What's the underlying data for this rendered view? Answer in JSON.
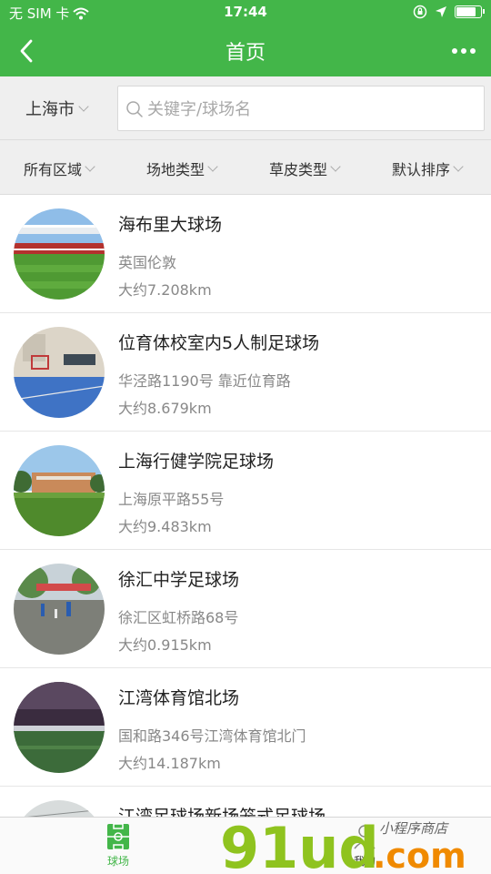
{
  "status_bar": {
    "carrier": "无 SIM 卡",
    "time": "17:44",
    "battery_level": 0.85
  },
  "nav": {
    "title": "首页",
    "back_icon": "chevron-left-icon",
    "more_icon": "more-dots-icon"
  },
  "search": {
    "city": "上海市",
    "placeholder": "关键字/球场名"
  },
  "filters": [
    {
      "label": "所有区域"
    },
    {
      "label": "场地类型"
    },
    {
      "label": "草皮类型"
    },
    {
      "label": "默认排序"
    }
  ],
  "venues": [
    {
      "name": "海布里大球场",
      "address": "英国伦敦",
      "distance": "大约7.208km"
    },
    {
      "name": "位育体校室内5人制足球场",
      "address": "华泾路1190号 靠近位育路",
      "distance": "大约8.679km"
    },
    {
      "name": "上海行健学院足球场",
      "address": "上海原平路55号",
      "distance": "大约9.483km"
    },
    {
      "name": "徐汇中学足球场",
      "address": "徐汇区虹桥路68号",
      "distance": "大约0.915km"
    },
    {
      "name": "江湾体育馆北场",
      "address": "国和路346号江湾体育馆北门",
      "distance": "大约14.187km"
    },
    {
      "name": "江湾足球场新场笼式足球场",
      "address": "",
      "distance": ""
    }
  ],
  "tabbar": {
    "tab1": "球场",
    "tab2": "我的"
  },
  "watermark": {
    "text1": "91ud",
    "text2": ".com",
    "text3": "小程序商店"
  },
  "colors": {
    "brand_green": "#43b649"
  }
}
